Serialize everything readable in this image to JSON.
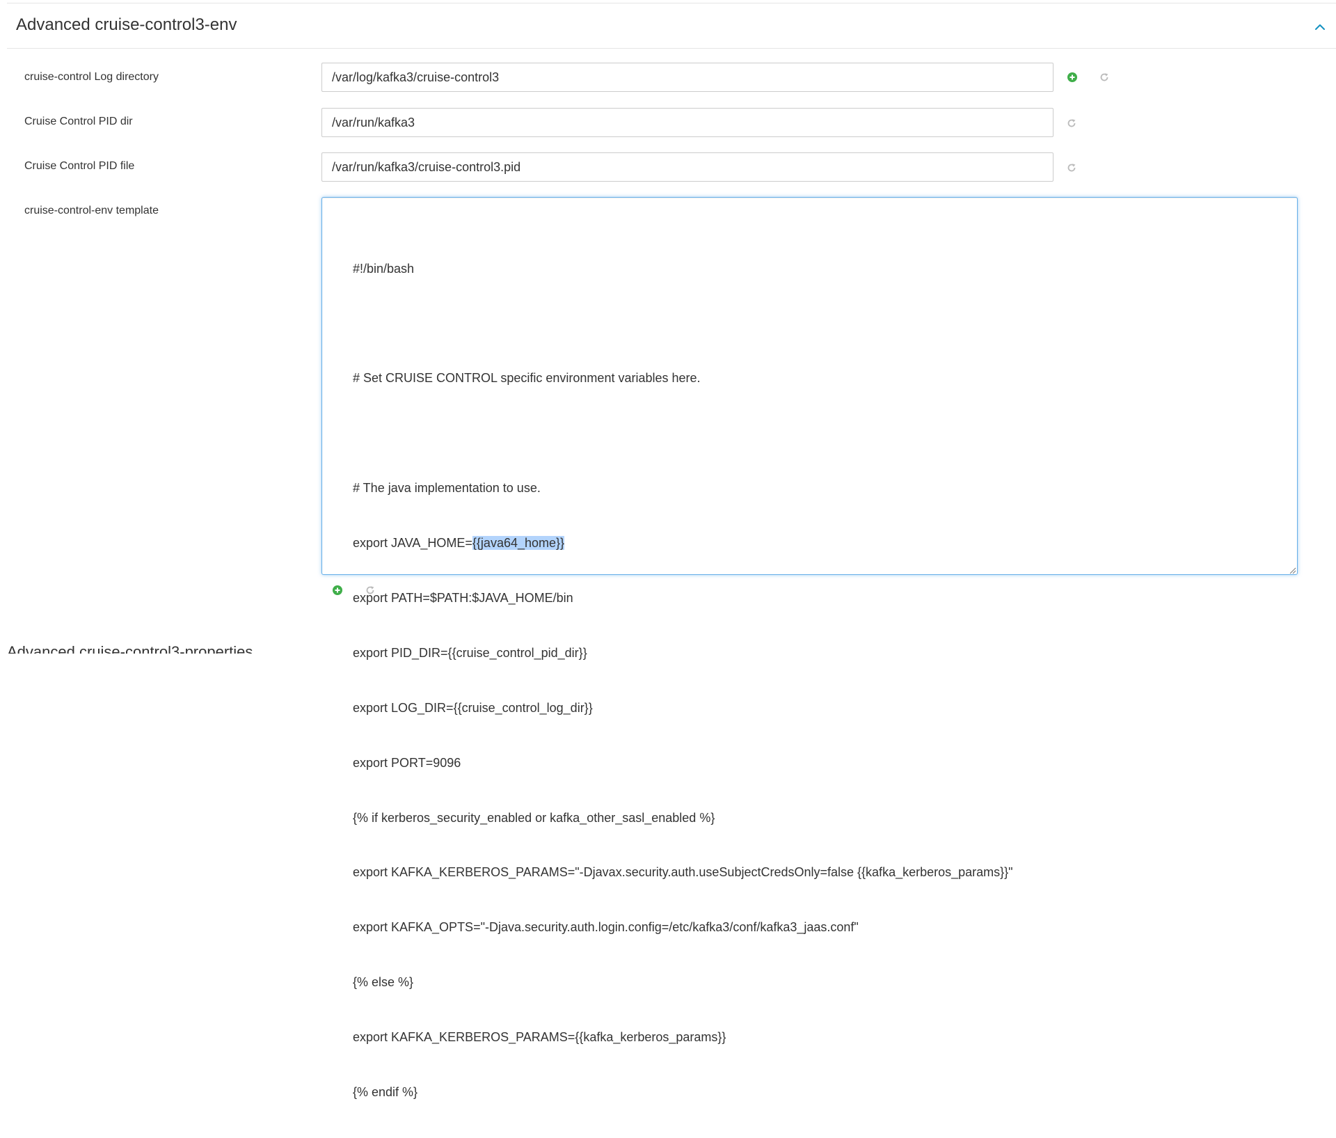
{
  "section": {
    "title": "Advanced cruise-control3-env"
  },
  "properties": [
    {
      "label": "cruise-control Log directory",
      "value": "/var/log/kafka3/cruise-control3"
    },
    {
      "label": "Cruise Control PID dir",
      "value": "/var/run/kafka3"
    },
    {
      "label": "Cruise Control PID file",
      "value": "/var/run/kafka3/cruise-control3.pid"
    }
  ],
  "template": {
    "label": "cruise-control-env template",
    "lines": [
      "#!/bin/bash",
      "",
      "# Set CRUISE CONTROL specific environment variables here.",
      "",
      "# The java implementation to use.",
      "export JAVA_HOME=",
      "export PATH=$PATH:$JAVA_HOME/bin",
      "export PID_DIR={{cruise_control_pid_dir}}",
      "export LOG_DIR={{cruise_control_log_dir}}",
      "export PORT=9096",
      "{% if kerberos_security_enabled or kafka_other_sasl_enabled %}",
      "export KAFKA_KERBEROS_PARAMS=\"-Djavax.security.auth.useSubjectCredsOnly=false {{kafka_kerberos_params}}\"",
      "export KAFKA_OPTS=\"-Djava.security.auth.login.config=/etc/kafka3/conf/kafka3_jaas.conf\"",
      "{% else %}",
      "export KAFKA_KERBEROS_PARAMS={{kafka_kerberos_params}}",
      "{% endif %}"
    ],
    "selected_text": "{{java64_home}}"
  },
  "next_section_peek": "Advanced cruise-control3-properties",
  "colors": {
    "accent": "#1491c1",
    "add_green": "#3fae49",
    "undo_gray": "#bbbbbb",
    "focus_border": "#66afe9",
    "selection": "#b3d4fc"
  },
  "icons": {
    "collapse": "chevron-up-icon",
    "add": "plus-circle-icon",
    "undo": "undo-icon",
    "resize": "resize-grip-icon"
  }
}
